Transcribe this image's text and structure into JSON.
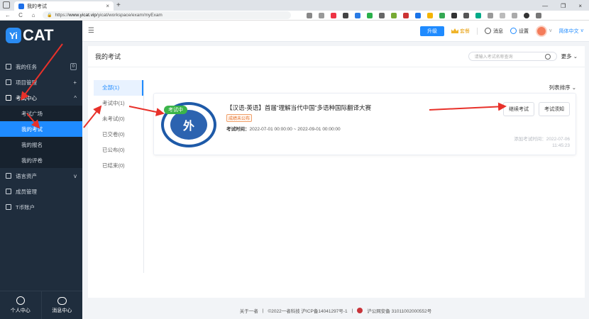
{
  "browser": {
    "tab_title": "我的考试",
    "tab_close": "×",
    "new_tab": "+",
    "url_prefix": "https://",
    "url_host": "www.yicat.vip",
    "url_path": "/yicat/workspace/exam/myExam",
    "window_controls": [
      "—",
      "❐",
      "×"
    ],
    "nav": {
      "back": "←",
      "refresh": "C",
      "home": "⌂",
      "lock": "🔒"
    }
  },
  "sidebar": {
    "logo_yi": "Yi",
    "logo_cat": "CAT",
    "items": [
      {
        "label": "我的任务",
        "count": "0"
      },
      {
        "label": "项目管理",
        "right": "+"
      },
      {
        "label": "考试中心",
        "right": "^"
      }
    ],
    "sub_items": [
      {
        "label": "考试广场"
      },
      {
        "label": "我的考试",
        "active": true
      },
      {
        "label": "我的报名"
      },
      {
        "label": "我的评卷"
      }
    ],
    "items_after": [
      {
        "label": "语言资产",
        "right": "v"
      },
      {
        "label": "成员管理"
      },
      {
        "label": "T币账户"
      }
    ],
    "bottom": {
      "personal": "个人中心",
      "messages": "消息中心"
    }
  },
  "topbar": {
    "collapse_icon": "☰",
    "upgrade": "升级",
    "vip": "套餐",
    "messages": "消息",
    "settings": "设置",
    "chevron": "v",
    "language": "简体中文",
    "language_chevron": "v"
  },
  "content": {
    "title": "我的考试",
    "search_placeholder": "请输入考试名称查询",
    "more": "更多",
    "sort": "列表排序",
    "filters": [
      "全部(1)",
      "考试中(1)",
      "未考试(0)",
      "已交卷(0)",
      "已公布(0)",
      "已结束(0)"
    ],
    "exam": {
      "badge": "考试中",
      "title": "【汉语-英语】首届“理解当代中国”多语种国际翻译大赛",
      "status_tag": "成绩未公布",
      "time_label": "考试时间：",
      "time_value": "2022-07-01 00:00:00 ~ 2022-09-01 00:00:00",
      "continue_button": "继续考试",
      "notice_button": "考试须知",
      "added_label": "添加考试时间：2022-07-06",
      "added_time": "11:45:23"
    }
  },
  "footer": {
    "about": "关于一者",
    "sep": "|",
    "copyright": "©2022一者科技 沪ICP备14041297号-1",
    "police": "沪公网安备 31011002000552号"
  },
  "colors": {
    "accent": "#1f8bff",
    "sidebar_bg": "#1f2d3d",
    "badge_green": "#3bb54a",
    "annotation_red": "#e8312a"
  }
}
